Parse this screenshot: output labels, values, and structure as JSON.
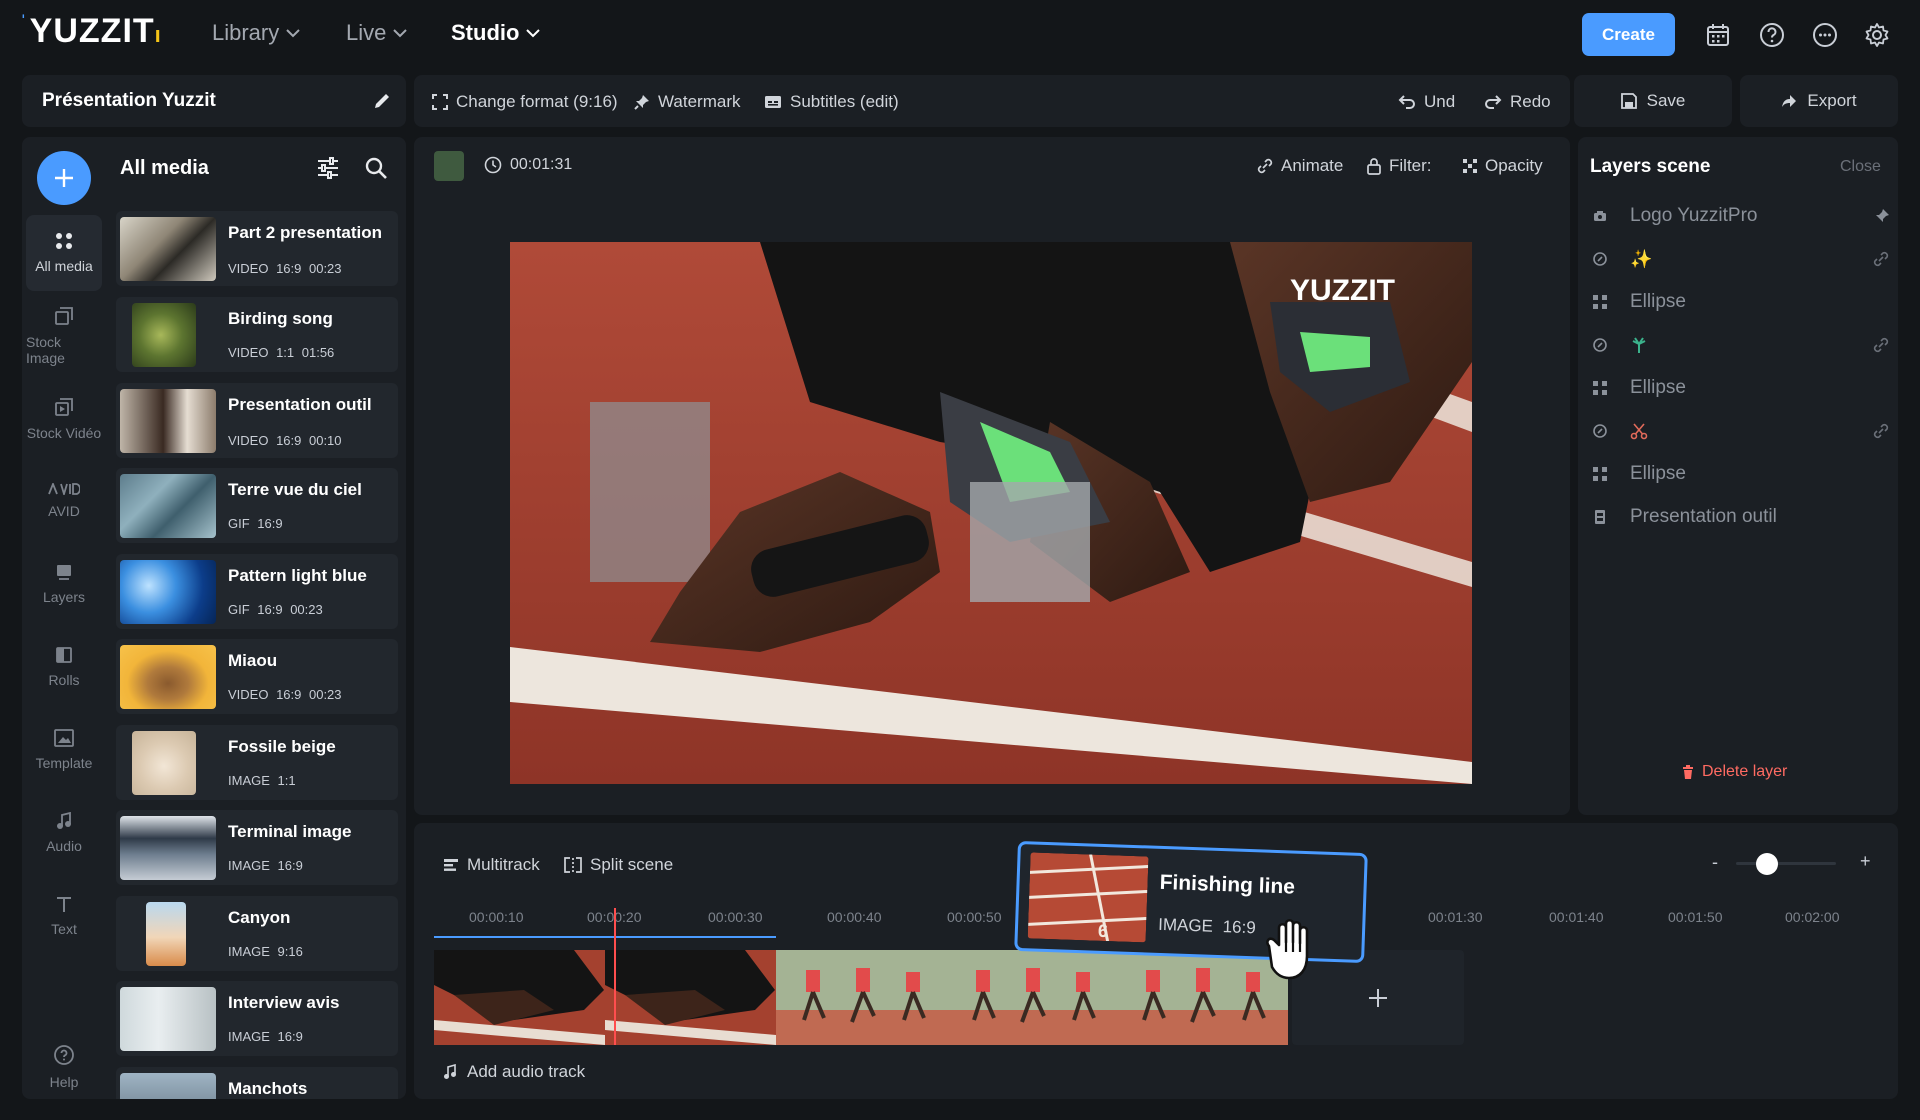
{
  "app": {
    "logo": "YUZZIT",
    "nav": [
      {
        "label": "Library"
      },
      {
        "label": "Live"
      },
      {
        "label": "Studio"
      }
    ],
    "create_label": "Create"
  },
  "project": {
    "title": "Présentation Yuzzit"
  },
  "toolbar": {
    "change_format": "Change format (9:16)",
    "watermark": "Watermark",
    "subtitles": "Subtitles (edit)",
    "undo": "Und",
    "redo": "Redo",
    "save": "Save",
    "export": "Export"
  },
  "sidebar": {
    "items": [
      {
        "label": "All media",
        "icon": "grid-icon"
      },
      {
        "label": "Stock Image",
        "icon": "stock-image-icon"
      },
      {
        "label": "Stock Vidéo",
        "icon": "stock-video-icon"
      },
      {
        "label": "AVID",
        "icon": "avid-icon"
      },
      {
        "label": "Layers",
        "icon": "layers-icon"
      },
      {
        "label": "Rolls",
        "icon": "rolls-icon"
      },
      {
        "label": "Template",
        "icon": "template-icon"
      },
      {
        "label": "Audio",
        "icon": "music-note-icon"
      },
      {
        "label": "Text",
        "icon": "text-icon"
      },
      {
        "label": "Help",
        "icon": "help-icon"
      }
    ]
  },
  "media_panel": {
    "title": "All media",
    "items": [
      {
        "title": "Part 2 presentation",
        "meta": "VIDEO 16:9 00:23"
      },
      {
        "title": "Birding song",
        "meta": "VIDEO 1:1 01:56"
      },
      {
        "title": "Presentation outil",
        "meta": "VIDEO 16:9 00:10"
      },
      {
        "title": "Terre vue du ciel",
        "meta": "GIF 16:9"
      },
      {
        "title": "Pattern light blue",
        "meta": "GIF 16:9 00:23"
      },
      {
        "title": "Miaou",
        "meta": "VIDEO 16:9 00:23"
      },
      {
        "title": "Fossile beige",
        "meta": "IMAGE 1:1"
      },
      {
        "title": "Terminal image",
        "meta": "IMAGE 16:9"
      },
      {
        "title": "Canyon",
        "meta": "IMAGE 9:16"
      },
      {
        "title": "Interview avis",
        "meta": "IMAGE 16:9"
      },
      {
        "title": "Manchots",
        "meta": ""
      }
    ]
  },
  "scene": {
    "timecode": "00:01:31",
    "tools": {
      "animate": "Animate",
      "filter": "Filter:",
      "opacity": "Opacity"
    },
    "preview_logo": "YUZZIT"
  },
  "layers": {
    "title": "Layers scene",
    "close": "Close",
    "items": [
      {
        "label": "Logo YuzzitPro",
        "icon": "camera-icon"
      },
      {
        "label": "",
        "icon": "sparkle-icon"
      },
      {
        "label": "Ellipse",
        "icon": "ellipse-icon"
      },
      {
        "label": "",
        "icon": "palm-icon"
      },
      {
        "label": "Ellipse",
        "icon": "ellipse-icon"
      },
      {
        "label": "",
        "icon": "scissors-icon"
      },
      {
        "label": "Ellipse",
        "icon": "ellipse-icon"
      },
      {
        "label": "Presentation outil",
        "icon": "film-icon"
      }
    ],
    "delete": "Delete layer"
  },
  "timeline": {
    "multitrack": "Multitrack",
    "split_scene": "Split scene",
    "ticks": [
      "00:00:10",
      "00:00:20",
      "00:00:30",
      "00:00:40",
      "00:00:50",
      "00:01:30",
      "00:01:40",
      "00:01:50",
      "00:02:00"
    ],
    "add_audio": "Add audio track",
    "zoom_minus": "-",
    "zoom_plus": "+"
  },
  "drag_card": {
    "title": "Finishing line",
    "meta": "IMAGE 16:9"
  },
  "colors": {
    "accent": "#4a9bff",
    "danger": "#ff6b62",
    "bg": "#131619",
    "panel": "#1b1f24"
  }
}
